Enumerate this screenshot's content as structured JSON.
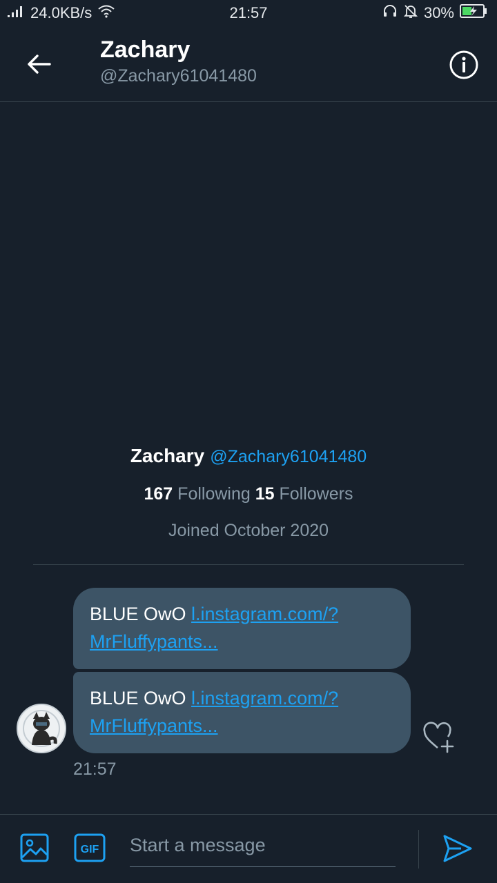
{
  "status_bar": {
    "network_speed": "24.0KB/s",
    "time": "21:57",
    "battery": "30%"
  },
  "header": {
    "title": "Zachary",
    "subtitle": "@Zachary61041480"
  },
  "profile": {
    "name": "Zachary",
    "handle": "@Zachary61041480",
    "following_count": "167",
    "following_label": "Following",
    "followers_count": "15",
    "followers_label": "Followers",
    "joined": "Joined October 2020"
  },
  "messages": [
    {
      "text": "BLUE OwO ",
      "link_line1": "l.instagram.com/?",
      "link_line2": "MrFluffypants..."
    },
    {
      "text": "BLUE OwO ",
      "link_line1": "l.instagram.com/?",
      "link_line2": "MrFluffypants..."
    }
  ],
  "message_time": "21:57",
  "composer": {
    "placeholder": "Start a message",
    "gif_label": "GIF"
  },
  "colors": {
    "background": "#17202b",
    "accent": "#1da1f2",
    "bubble": "#3d5466",
    "muted_text": "#8899a6",
    "divider": "#38444d"
  }
}
